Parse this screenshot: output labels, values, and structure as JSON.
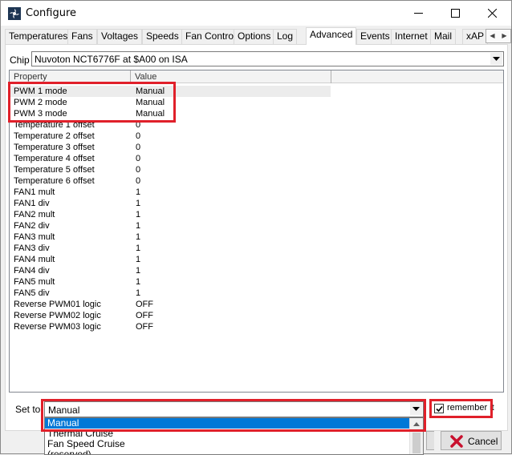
{
  "window": {
    "title": "Configure"
  },
  "tabs": [
    {
      "label": "Temperatures"
    },
    {
      "label": "Fans"
    },
    {
      "label": "Voltages"
    },
    {
      "label": "Speeds"
    },
    {
      "label": "Fan Control"
    },
    {
      "label": "Options"
    },
    {
      "label": "Log"
    },
    {
      "label": "Advanced"
    },
    {
      "label": "Events"
    },
    {
      "label": "Internet"
    },
    {
      "label": "Mail"
    },
    {
      "label": "xAP"
    }
  ],
  "chip": {
    "label": "Chip",
    "value": "Nuvoton NCT6776F at $A00 on ISA"
  },
  "table": {
    "headers": [
      "Property",
      "Value"
    ],
    "rows": [
      {
        "property": "PWM 1 mode",
        "value": "Manual"
      },
      {
        "property": "PWM 2 mode",
        "value": "Manual"
      },
      {
        "property": "PWM 3 mode",
        "value": "Manual"
      },
      {
        "property": "Temperature 1 offset",
        "value": "0"
      },
      {
        "property": "Temperature 2 offset",
        "value": "0"
      },
      {
        "property": "Temperature 3 offset",
        "value": "0"
      },
      {
        "property": "Temperature 4 offset",
        "value": "0"
      },
      {
        "property": "Temperature 5 offset",
        "value": "0"
      },
      {
        "property": "Temperature 6 offset",
        "value": "0"
      },
      {
        "property": "FAN1 mult",
        "value": "1"
      },
      {
        "property": "FAN1 div",
        "value": "1"
      },
      {
        "property": "FAN2 mult",
        "value": "1"
      },
      {
        "property": "FAN2 div",
        "value": "1"
      },
      {
        "property": "FAN3 mult",
        "value": "1"
      },
      {
        "property": "FAN3 div",
        "value": "1"
      },
      {
        "property": "FAN4 mult",
        "value": "1"
      },
      {
        "property": "FAN4 div",
        "value": "1"
      },
      {
        "property": "FAN5 mult",
        "value": "1"
      },
      {
        "property": "FAN5 div",
        "value": "1"
      },
      {
        "property": "Reverse PWM01 logic",
        "value": "OFF"
      },
      {
        "property": "Reverse PWM02 logic",
        "value": "OFF"
      },
      {
        "property": "Reverse PWM03 logic",
        "value": "OFF"
      }
    ]
  },
  "set_to": {
    "label": "Set to",
    "value": "Manual",
    "options": [
      "Manual",
      "Thermal Cruise",
      "Fan Speed Cruise",
      "(reserved)"
    ]
  },
  "remember": {
    "label": "remember it",
    "checked": true
  },
  "buttons": {
    "cancel": "Cancel"
  },
  "colors": {
    "highlight": "#e0202a",
    "selection": "#0078d7",
    "cancel_icon": "#c8102e"
  }
}
